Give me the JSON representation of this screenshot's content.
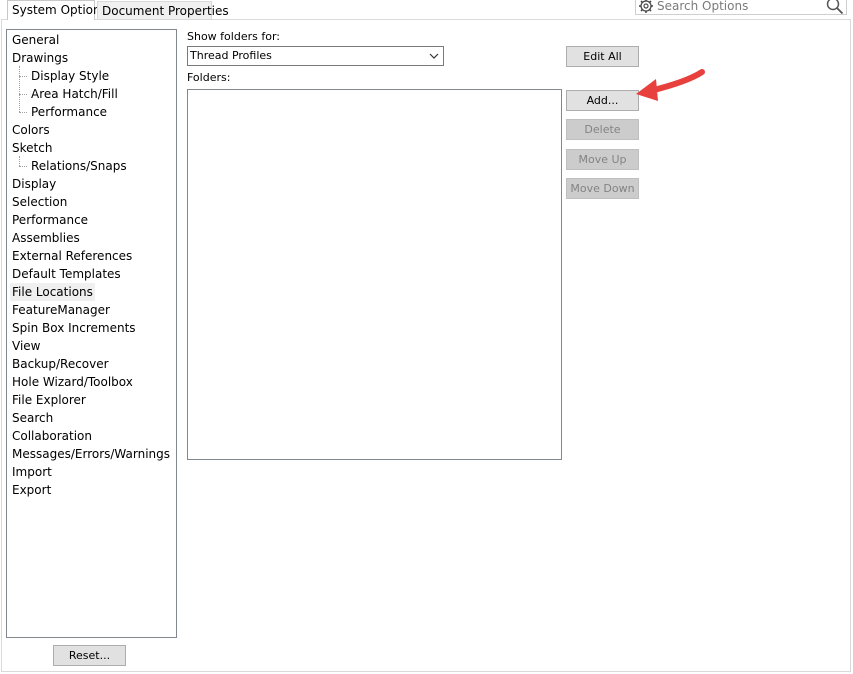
{
  "tabs": {
    "system_options": "System Options",
    "document_properties": "Document Properties"
  },
  "search": {
    "placeholder": "Search Options"
  },
  "tree": {
    "items": [
      {
        "label": "General",
        "level": 0
      },
      {
        "label": "Drawings",
        "level": 0
      },
      {
        "label": "Display Style",
        "level": 1
      },
      {
        "label": "Area Hatch/Fill",
        "level": 1
      },
      {
        "label": "Performance",
        "level": 1
      },
      {
        "label": "Colors",
        "level": 0
      },
      {
        "label": "Sketch",
        "level": 0
      },
      {
        "label": "Relations/Snaps",
        "level": 1
      },
      {
        "label": "Display",
        "level": 0
      },
      {
        "label": "Selection",
        "level": 0
      },
      {
        "label": "Performance",
        "level": 0
      },
      {
        "label": "Assemblies",
        "level": 0
      },
      {
        "label": "External References",
        "level": 0
      },
      {
        "label": "Default Templates",
        "level": 0
      },
      {
        "label": "File Locations",
        "level": 0,
        "selected": true
      },
      {
        "label": "FeatureManager",
        "level": 0
      },
      {
        "label": "Spin Box Increments",
        "level": 0
      },
      {
        "label": "View",
        "level": 0
      },
      {
        "label": "Backup/Recover",
        "level": 0
      },
      {
        "label": "Hole Wizard/Toolbox",
        "level": 0
      },
      {
        "label": "File Explorer",
        "level": 0
      },
      {
        "label": "Search",
        "level": 0
      },
      {
        "label": "Collaboration",
        "level": 0
      },
      {
        "label": "Messages/Errors/Warnings",
        "level": 0
      },
      {
        "label": "Import",
        "level": 0
      },
      {
        "label": "Export",
        "level": 0
      }
    ]
  },
  "main": {
    "show_folders_label": "Show folders for:",
    "show_folders_value": "Thread Profiles",
    "folders_label": "Folders:",
    "folders": []
  },
  "buttons": {
    "edit_all": "Edit All",
    "add": "Add...",
    "delete": "Delete",
    "move_up": "Move Up",
    "move_down": "Move Down",
    "reset": "Reset..."
  },
  "colors": {
    "annotation_arrow": "#e8403c"
  }
}
